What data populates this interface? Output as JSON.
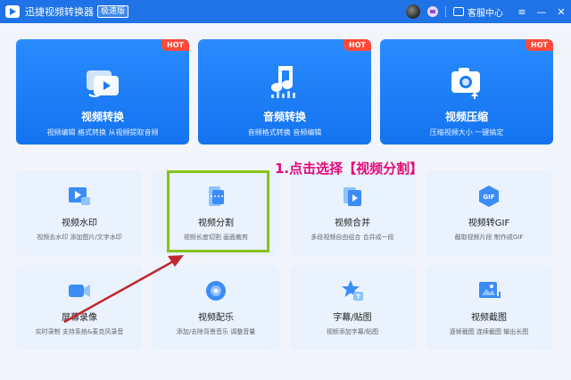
{
  "app": {
    "title": "迅捷视频转换器",
    "badge": "极速版",
    "help_label": "客服中心",
    "window_controls": {
      "menu": "≡",
      "minimize": "—",
      "close": "✕"
    }
  },
  "big_cards": [
    {
      "title": "视频转换",
      "desc": "视频编辑 格式转换 从视频提取音频",
      "tag": "HOT",
      "icon": "video-convert-icon"
    },
    {
      "title": "音频转换",
      "desc": "音频格式转换 音频编辑",
      "tag": "HOT",
      "icon": "music-note-icon"
    },
    {
      "title": "视频压缩",
      "desc": "压缩视频大小 一键搞定",
      "tag": "HOT",
      "icon": "camera-compress-icon"
    }
  ],
  "small_cards": [
    {
      "title": "视频水印",
      "desc": "视频去水印 添加图片/文字水印",
      "icon": "video-watermark-icon"
    },
    {
      "title": "视频分割",
      "desc": "视频长度切割 画面裁剪",
      "icon": "video-split-icon"
    },
    {
      "title": "视频合并",
      "desc": "多段视频自由组合 合并成一段",
      "icon": "video-merge-icon"
    },
    {
      "title": "视频转GIF",
      "desc": "截取视频片段 制作成GIF",
      "icon": "gif-icon"
    },
    {
      "title": "屏幕录像",
      "desc": "实时录制 支持系统&麦克风录音",
      "icon": "screen-record-icon"
    },
    {
      "title": "视频配乐",
      "desc": "添加/去除背景音乐 调整音量",
      "icon": "video-music-icon"
    },
    {
      "title": "字幕/贴图",
      "desc": "视频添加字幕/贴图",
      "icon": "subtitle-icon"
    },
    {
      "title": "视频截图",
      "desc": "逐帧截图 连续截图 输出长图",
      "icon": "screenshot-icon"
    }
  ],
  "annotation": {
    "instruction": "1.点击选择【视频分割】",
    "highlight_color": "#86c21a",
    "arrow_color": "#c0282d",
    "text_color": "#e4087a"
  },
  "colors": {
    "titlebar": "#1f73e6",
    "card_blue": "#1a7cf5",
    "hot_tag": "#ff4a3a",
    "small_card_bg": "#e9f2fd"
  }
}
